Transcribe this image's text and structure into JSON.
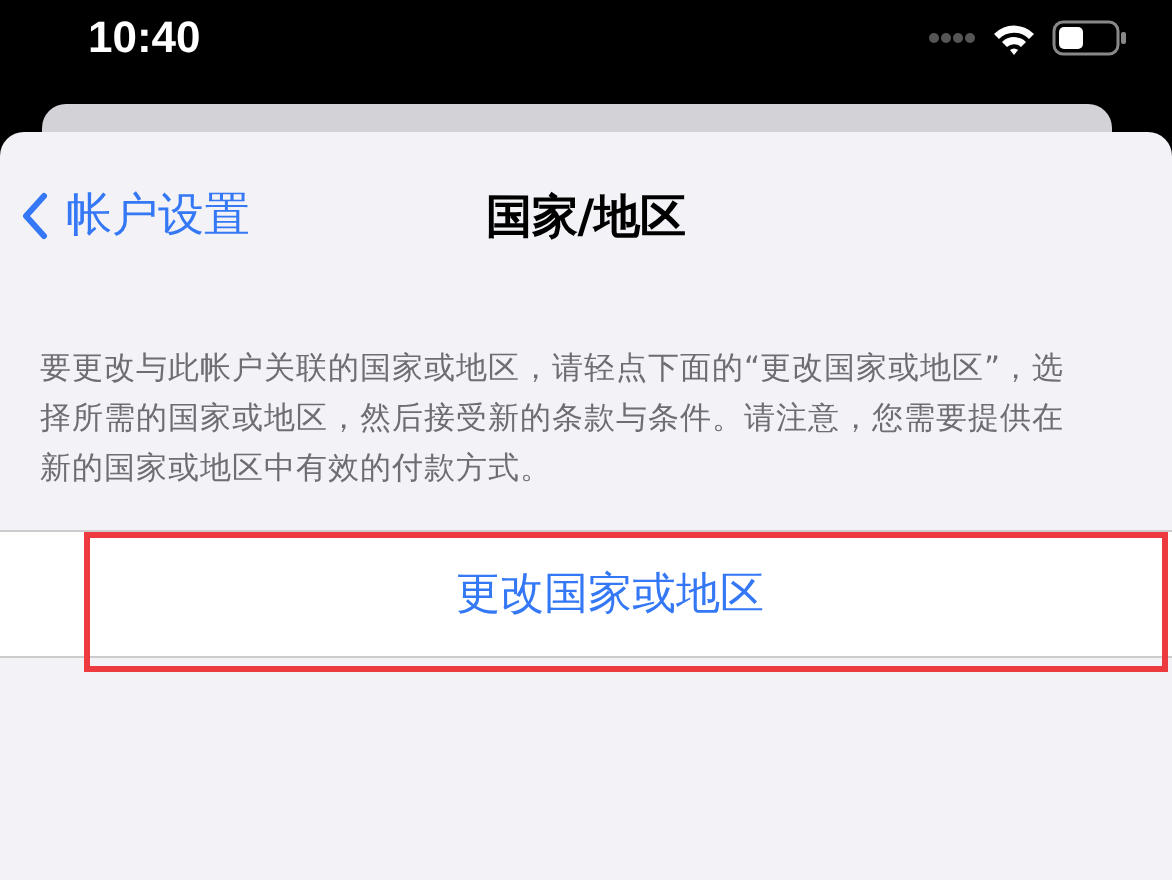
{
  "status_bar": {
    "time": "10:40"
  },
  "nav": {
    "back": "帐户设置",
    "title": "国家/地区"
  },
  "description": "要更改与此帐户关联的国家或地区，请轻点下面的“更改国家或地区”，选择所需的国家或地区，然后接受新的条款与条件。请注意，您需要提供在新的国家或地区中有效的付款方式。",
  "action": {
    "label": "更改国家或地区",
    "highlighted": true
  }
}
